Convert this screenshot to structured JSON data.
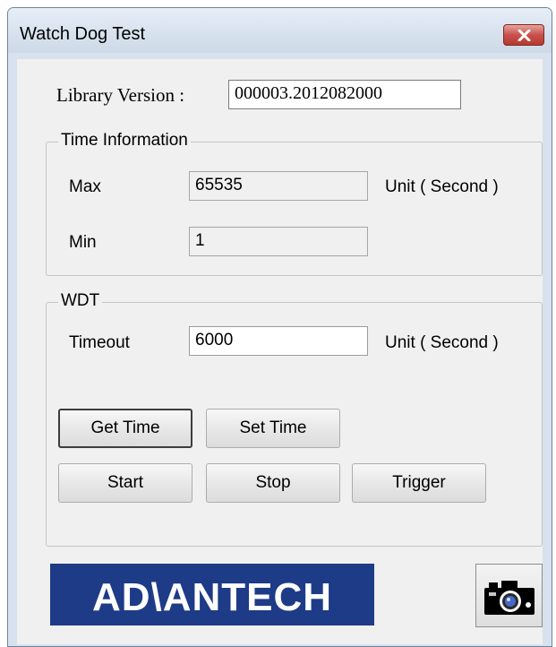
{
  "window": {
    "title": "Watch Dog Test"
  },
  "library": {
    "label": "Library Version :",
    "value": "000003.2012082000"
  },
  "time_info": {
    "group_title": "Time Information",
    "max_label": "Max",
    "max_value": "65535",
    "min_label": "Min",
    "min_value": "1",
    "unit_label": "Unit ( Second )"
  },
  "wdt": {
    "group_title": "WDT",
    "timeout_label": "Timeout",
    "timeout_value": "6000",
    "unit_label": "Unit ( Second )",
    "buttons": {
      "get_time": "Get Time",
      "set_time": "Set Time",
      "start": "Start",
      "stop": "Stop",
      "trigger": "Trigger"
    }
  },
  "logo": {
    "brand": "ADVANTECH",
    "color": "#1d3b87"
  },
  "icons": {
    "close": "close-icon",
    "camera": "camera-icon"
  }
}
